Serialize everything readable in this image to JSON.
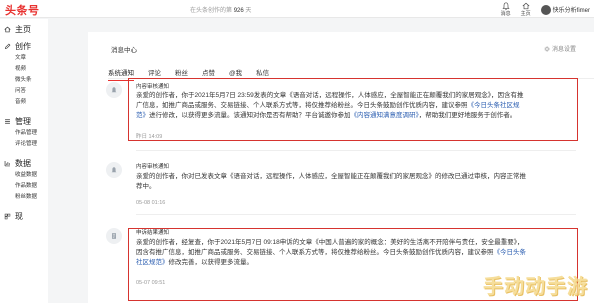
{
  "header": {
    "logo": "头条号",
    "counter_prefix": "在头条创作的第",
    "counter_num": "926",
    "counter_suffix": "天",
    "message_label": "消息",
    "home_label": "主页",
    "user_name": "快乐分析fimer"
  },
  "sidebar": {
    "home": "主页",
    "create": {
      "label": "创作",
      "items": [
        "文章",
        "视频",
        "微头条",
        "问答",
        "音频"
      ]
    },
    "manage": {
      "label": "管理",
      "items": [
        "作品管理",
        "评论管理"
      ]
    },
    "data": {
      "label": "数据",
      "items": [
        "收益数据",
        "作品数据",
        "粉丝数据"
      ]
    },
    "more": "现"
  },
  "main": {
    "title": "消息中心",
    "settings": "消息设置",
    "tabs": [
      "系统通知",
      "评论",
      "粉丝",
      "点赞",
      "@我",
      "私信"
    ]
  },
  "messages": [
    {
      "type": "内容审核通知",
      "body_a": "亲爱的创作者，你于2021年5月7日 23:59发表的文章《语音对话，远程操作，人体感应，全屋智能正在颠覆我们的家居观念》，因含有推",
      "body_b": "广信息，如推广商品或服务、交易链接、个人联系方式等，将仅推荐给粉丝。今日头条鼓励创作优质内容，建议参照",
      "link1": "《今日头条社区规",
      "link1b": "范》",
      "body_c": "进行修改，以获得更多流量。该通知对你是否有帮助？平台诚邀你参加",
      "link2": "《内容通知满意度调研》",
      "body_d": "，帮助我们更好地服务于创作者。",
      "time": "昨日 14:09"
    },
    {
      "type": "内容审核通知",
      "body_a": "亲爱的创作者，你对已发表文章《语音对话，远程操作，人体感应，全屋智能正在颠覆我们的家居观念》的修改已通过审核，内容正常推",
      "body_b": "荐中。",
      "time": "05-08 01:16"
    },
    {
      "type": "申诉结果通知",
      "body_a": "亲爱的创作者，经复查，你于2021年5月7日 09:18申诉的文章《中国人普遍的家的概念：美好的生活离不开陪伴与责任，安全最重要》，",
      "body_b": "因含有推广信息，如推广商品或服务、交易链接、个人联系方式等，将仅推荐给粉丝。今日头条鼓励创作优质内容，建议参照",
      "link1": "《今日头条",
      "link1b": "社区规范》",
      "body_c": "修改完善，以获得更多流量。",
      "time": "05-07 09:51"
    }
  ],
  "watermark": "手动动手游",
  "colors": {
    "brand": "#e8312f",
    "link": "#2a5db0",
    "highlight": "#d6342f"
  }
}
